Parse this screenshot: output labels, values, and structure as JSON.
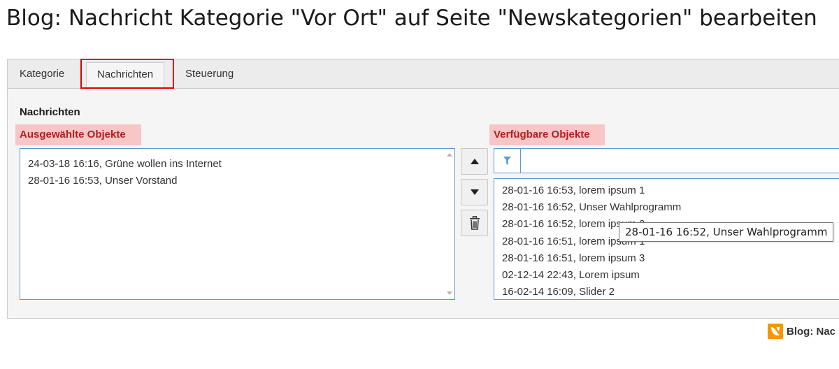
{
  "page": {
    "title": "Blog: Nachricht Kategorie \"Vor Ort\" auf Seite \"Newskategorien\" bearbeiten"
  },
  "tabs": [
    {
      "label": "Kategorie",
      "active": false
    },
    {
      "label": "Nachrichten",
      "active": true
    },
    {
      "label": "Steuerung",
      "active": false
    }
  ],
  "section": {
    "title": "Nachrichten"
  },
  "selected": {
    "label": "Ausgewählte Objekte",
    "items": [
      "24-03-18 16:16, Grüne wollen ins Internet",
      "28-01-16 16:53, Unser Vorstand"
    ]
  },
  "available": {
    "label": "Verfügbare Objekte",
    "filter_value": "",
    "items": [
      "28-01-16 16:53, lorem ipsum 1",
      "28-01-16 16:52, Unser Wahlprogramm",
      "28-01-16 16:52, lorem ipsum 2",
      "28-01-16 16:51, lorem ipsum 1",
      "28-01-16 16:51, lorem ipsum 3",
      "02-12-14 22:43, Lorem ipsum",
      "16-02-14 16:09, Slider 2"
    ]
  },
  "tooltip": {
    "text": "28-01-16 16:52, Unser Wahlprogramm"
  },
  "footer": {
    "breadcrumb_text": "Blog: Nac"
  },
  "icons": {
    "move_up": "triangle-up-icon",
    "move_down": "triangle-down-icon",
    "delete": "trash-icon",
    "filter": "filter-icon",
    "footer_logo": "typo3-logo-icon"
  },
  "colors": {
    "highlight_border": "#e00000",
    "label_background": "#f8c6c6",
    "label_text": "#b21f1f",
    "listbox_border": "#5a9bd4",
    "filter_icon": "#5a9bd4",
    "logo": "#f49700"
  }
}
